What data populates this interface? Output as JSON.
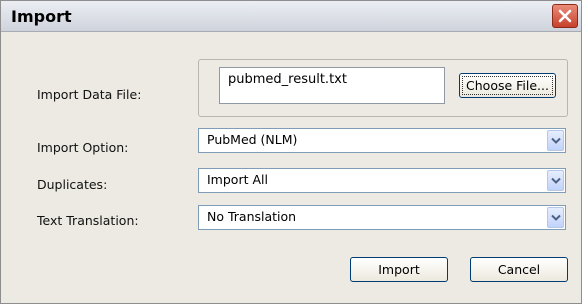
{
  "dialog": {
    "title": "Import",
    "close_icon": "close-icon",
    "colors": {
      "close_button": "#c7412b",
      "border": "#003c74"
    }
  },
  "fields": {
    "import_data_file": {
      "label": "Import Data File:",
      "value": "pubmed_result.txt",
      "button": "Choose File..."
    },
    "import_option": {
      "label": "Import Option:",
      "value": "PubMed (NLM)"
    },
    "duplicates": {
      "label": "Duplicates:",
      "value": "Import All"
    },
    "text_translation": {
      "label": "Text Translation:",
      "value": "No Translation"
    }
  },
  "buttons": {
    "import": "Import",
    "cancel": "Cancel"
  }
}
